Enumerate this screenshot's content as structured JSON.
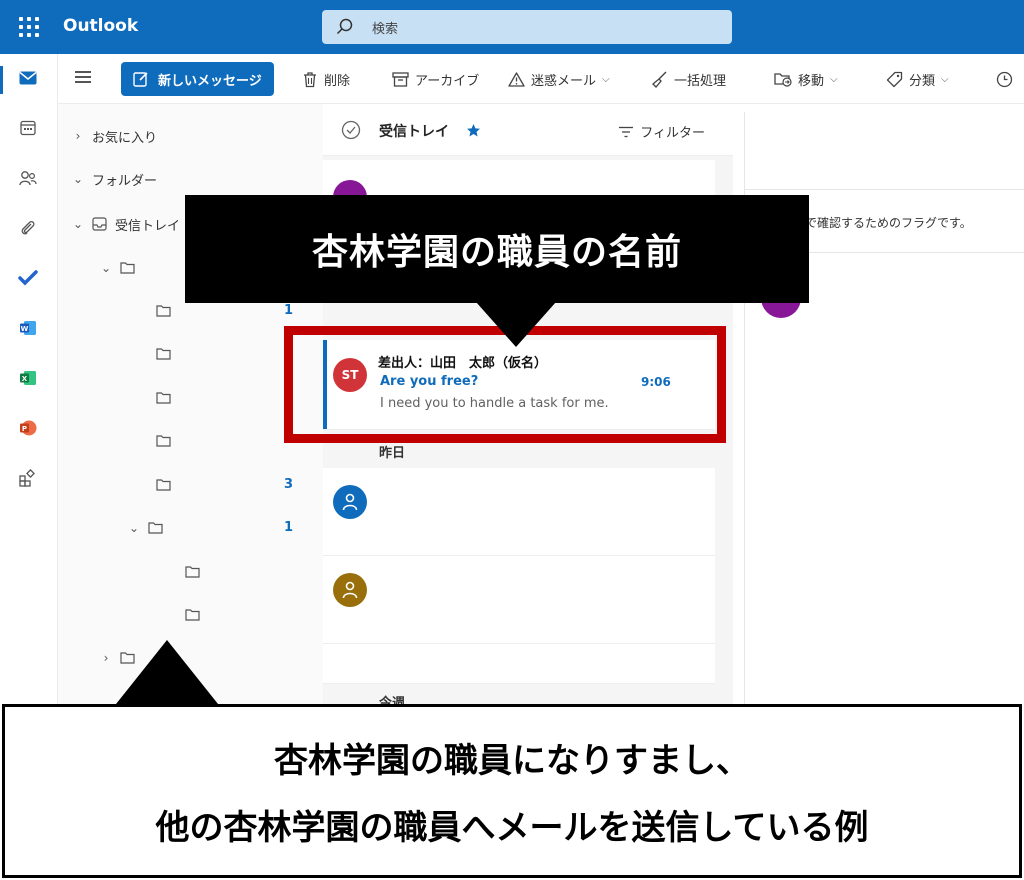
{
  "app": {
    "title": "Outlook"
  },
  "search": {
    "placeholder": "検索"
  },
  "toolbar": {
    "new_message": "新しいメッセージ",
    "delete": "削除",
    "archive": "アーカイブ",
    "junk": "迷惑メール",
    "sweep": "一括処理",
    "move": "移動",
    "categorize": "分類"
  },
  "folders": {
    "favorites": "お気に入り",
    "folders": "フォルダー",
    "inbox": "受信トレイ",
    "counts": [
      "1",
      "3",
      "1"
    ]
  },
  "list": {
    "title": "受信トレイ",
    "filter": "フィルター",
    "yesterday": "昨日",
    "this_week": "今週",
    "highlighted": {
      "initials": "ST",
      "sender": "差出人：山田　太郎（仮名）",
      "subject": "Are you free?",
      "time": "9:06",
      "preview": "I need you to handle a task for me."
    }
  },
  "reading": {
    "flag_text": "で確認するためのフラグです。"
  },
  "annotation": {
    "callout": "杏林学園の職員の名前",
    "caption_line1": "杏林学園の職員になりすまし、",
    "caption_line2": "他の杏林学園の職員へメールを送信している例"
  },
  "colors": {
    "brand": "#0f6cbd",
    "highlight": "#c00000",
    "avatar_st": "#d13438",
    "avatar_blue": "#0f6cbd",
    "avatar_brown": "#986f0b",
    "avatar_purple": "#881798"
  }
}
